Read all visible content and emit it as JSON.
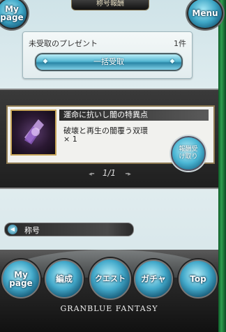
{
  "header": {
    "title": "称号報酬",
    "mypage_label": "My page",
    "menu_label": "Menu"
  },
  "gifts": {
    "label": "未受取のプレゼント",
    "count": "1件",
    "bulk_claim_label": "一括受取"
  },
  "reward": {
    "title": "運命に抗いし闇の特異点",
    "item_name": "破壊と再生の闇覆う双環",
    "quantity": "× 1",
    "claim_label": "報酬受け取り",
    "item_icon": "purple-crystal-icon"
  },
  "pager": {
    "text": "1/1"
  },
  "section": {
    "label": "称号",
    "icon": "back-arrow-icon"
  },
  "nav": {
    "items": [
      {
        "label": "My page"
      },
      {
        "label": "編成"
      },
      {
        "label": "クエスト"
      },
      {
        "label": "ガチャ"
      },
      {
        "label": "Top"
      }
    ]
  },
  "logo": {
    "text": "GRANBLUE FANTASY"
  }
}
